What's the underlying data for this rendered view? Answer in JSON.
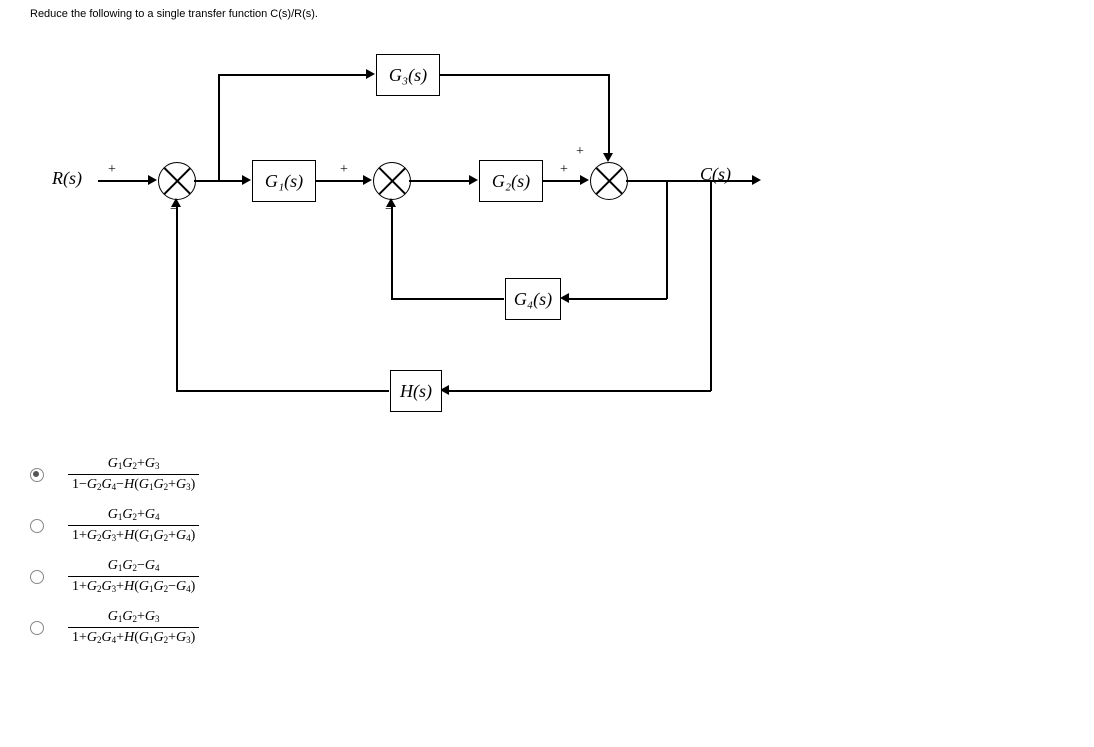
{
  "prompt": "Reduce the following to a single transfer function C(s)/R(s).",
  "signals": {
    "input": "R(s)",
    "output": "C(s)"
  },
  "blocks": {
    "G1": "G₁(s)",
    "G2": "G₂(s)",
    "G3": "G₃(s)",
    "G4": "G₄(s)",
    "H": "H(s)"
  },
  "sums": {
    "s1": {
      "top": "",
      "left": "+",
      "bottom": "−"
    },
    "s2": {
      "top": "",
      "left": "+",
      "bottom": "−"
    },
    "s3": {
      "top": "+",
      "left": "+",
      "bottom": ""
    }
  },
  "options": [
    {
      "selected": true,
      "num_parts": [
        "G",
        "1",
        "G",
        "2",
        "+",
        "G",
        "3"
      ],
      "den_pre": [
        "1",
        "−",
        "G",
        "2",
        "G",
        "4",
        "−",
        "H"
      ],
      "den_par": [
        "G",
        "1",
        "G",
        "2",
        "+",
        "G",
        "3"
      ]
    },
    {
      "selected": false,
      "num_parts": [
        "G",
        "1",
        "G",
        "2",
        "+",
        "G",
        "4"
      ],
      "den_pre": [
        "1",
        "+",
        "G",
        "2",
        "G",
        "3",
        "+",
        "H"
      ],
      "den_par": [
        "G",
        "1",
        "G",
        "2",
        "+",
        "G",
        "4"
      ]
    },
    {
      "selected": false,
      "num_parts": [
        "G",
        "1",
        "G",
        "2",
        "−",
        "G",
        "4"
      ],
      "den_pre": [
        "1",
        "+",
        "G",
        "2",
        "G",
        "3",
        "+",
        "H"
      ],
      "den_par": [
        "G",
        "1",
        "G",
        "2",
        "−",
        "G",
        "4"
      ]
    },
    {
      "selected": false,
      "num_parts": [
        "G",
        "1",
        "G",
        "2",
        "+",
        "G",
        "3"
      ],
      "den_pre": [
        "1",
        "+",
        "G",
        "2",
        "G",
        "4",
        "+",
        "H"
      ],
      "den_par": [
        "G",
        "1",
        "G",
        "2",
        "+",
        "G",
        "3"
      ]
    }
  ]
}
